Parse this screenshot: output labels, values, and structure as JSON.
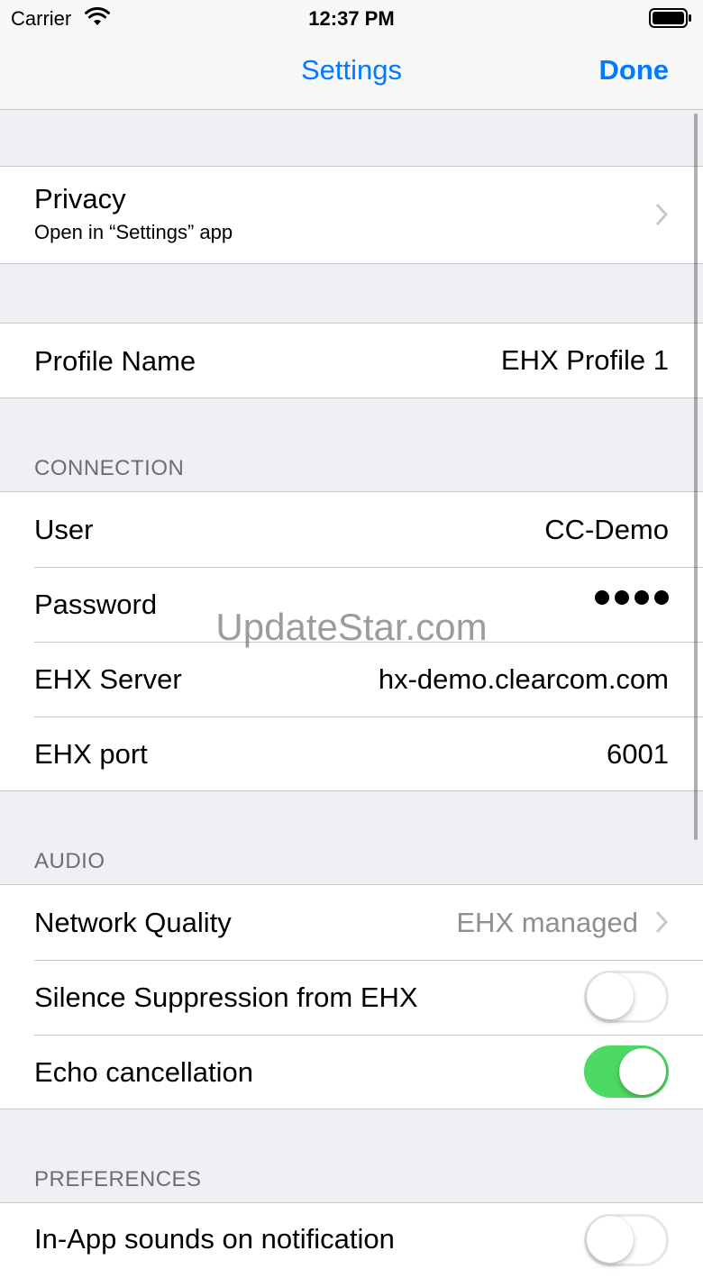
{
  "status_bar": {
    "carrier": "Carrier",
    "time": "12:37 PM"
  },
  "nav": {
    "title": "Settings",
    "done_label": "Done",
    "accent_color": "#007aff"
  },
  "privacy": {
    "title": "Privacy",
    "subtitle": "Open in “Settings” app"
  },
  "profile": {
    "label": "Profile Name",
    "value": "EHX Profile 1"
  },
  "connection": {
    "header": "CONNECTION",
    "user_label": "User",
    "user_value": "CC-Demo",
    "password_label": "Password",
    "password_dot_count": 4,
    "server_label": "EHX Server",
    "server_value": "hx-demo.clearcom.com",
    "port_label": "EHX port",
    "port_value": "6001"
  },
  "audio": {
    "header": "AUDIO",
    "network_label": "Network Quality",
    "network_value": "EHX managed",
    "silence_label": "Silence Suppression from EHX",
    "silence_on": false,
    "echo_label": "Echo cancellation",
    "echo_on": true,
    "toggle_on_color": "#4cd964"
  },
  "preferences": {
    "header": "PREFERENCES",
    "sounds_label": "In-App sounds on notification",
    "sounds_on": false
  },
  "watermark": "UpdateStar.com"
}
